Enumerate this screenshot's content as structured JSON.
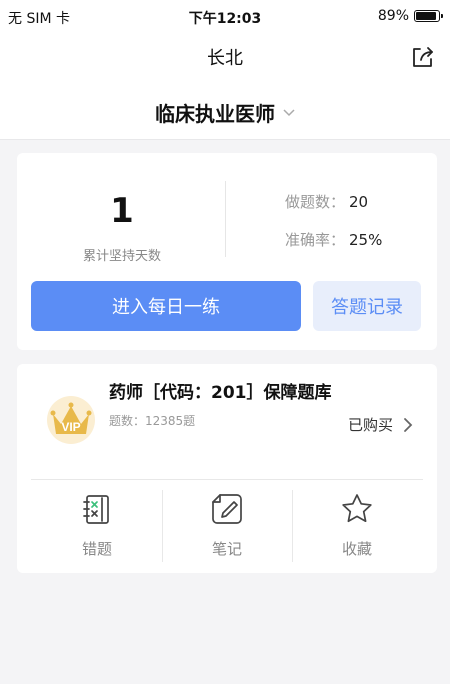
{
  "status_bar": {
    "carrier": "无 SIM 卡",
    "time": "下午12:03",
    "battery": "89%",
    "battery_level": 0.89
  },
  "nav": {
    "title": "长北",
    "share_icon": "share-icon"
  },
  "subject": {
    "title": "临床执业医师",
    "dropdown_icon": "chevron-down-icon"
  },
  "stats": {
    "days_value": "1",
    "days_label": "累计坚持天数",
    "count_label": "做题数：",
    "count_value": "20",
    "accuracy_label": "准确率：",
    "accuracy_value": "25%",
    "primary_button": "进入每日一练",
    "secondary_button": "答题记录"
  },
  "bank": {
    "badge_text": "VIP",
    "title": "药师［代码：201］保障题库",
    "count": "题数：12385题",
    "status": "已购买"
  },
  "actions": [
    {
      "label": "错题",
      "icon": "wrong-questions-icon"
    },
    {
      "label": "笔记",
      "icon": "notes-icon"
    },
    {
      "label": "收藏",
      "icon": "star-icon"
    }
  ],
  "colors": {
    "accent": "#5b8df5",
    "accent_light": "#e8eefb",
    "vip_gold": "#e8b94a"
  }
}
